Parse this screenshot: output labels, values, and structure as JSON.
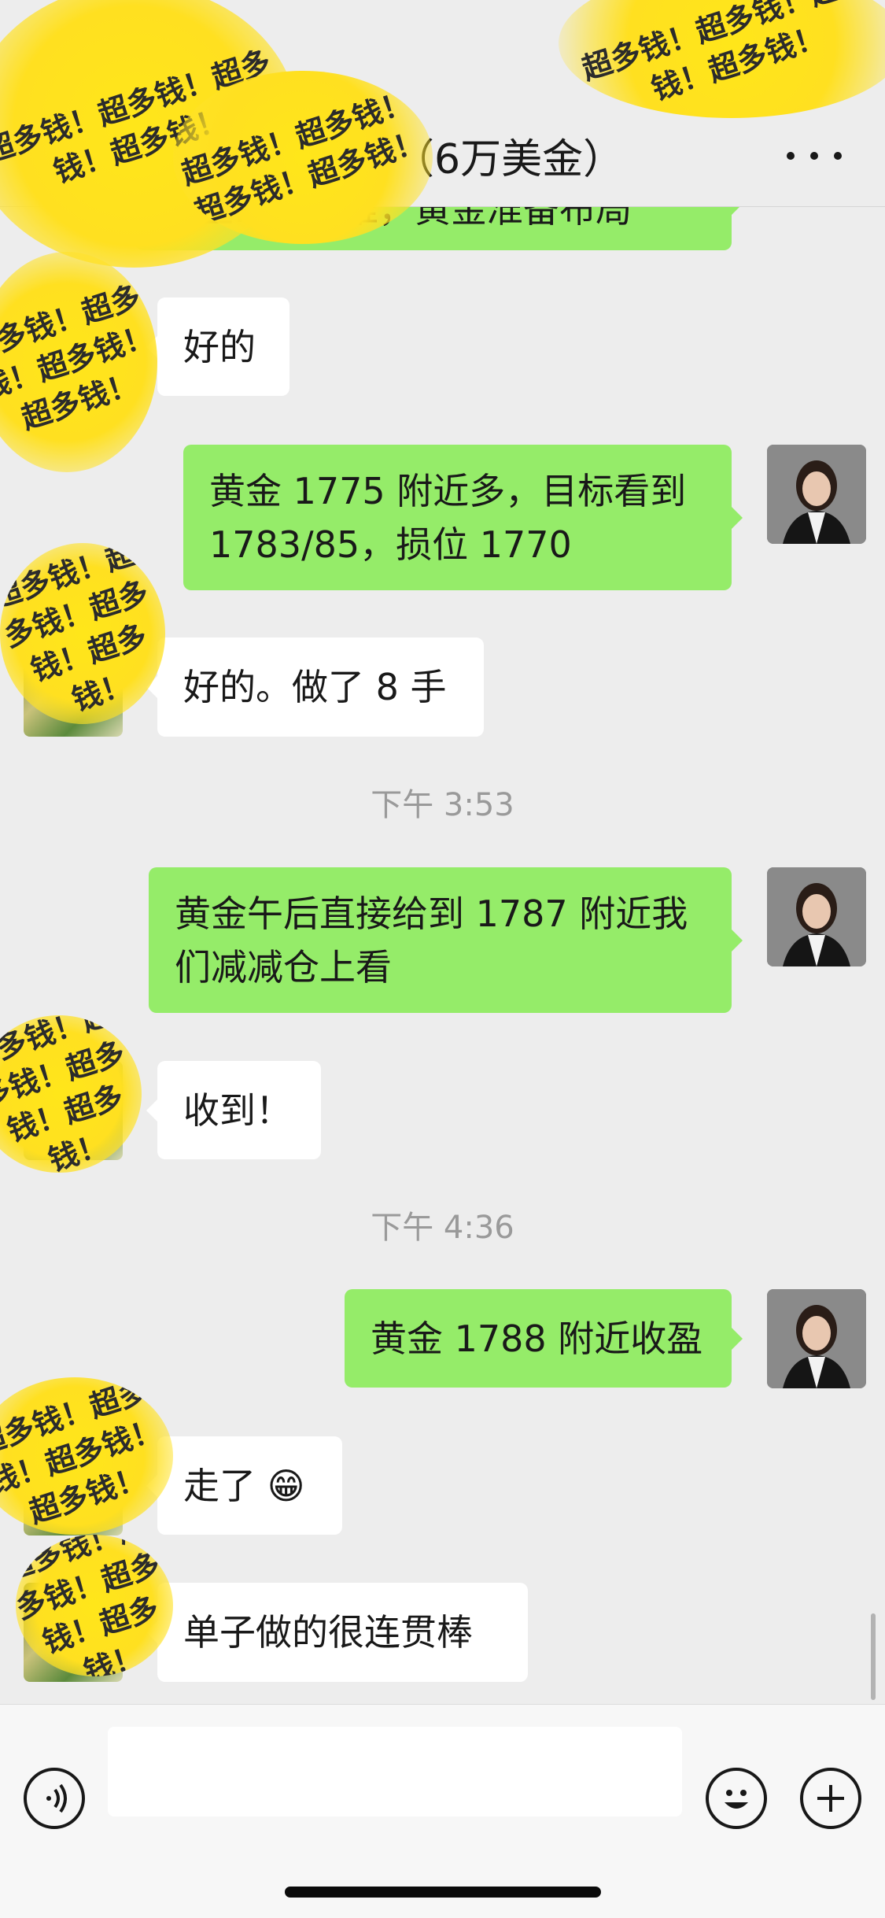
{
  "header": {
    "title": "（6万美金）",
    "more_icon": "more-dots-icon"
  },
  "messages": [
    {
      "side": "out",
      "text": "接上……思维，黄金准备布局"
    },
    {
      "side": "in",
      "text": "好的"
    },
    {
      "side": "out",
      "text": "黄金 1775 附近多，目标看到 1783/85，损位 1770"
    },
    {
      "side": "in",
      "text": "好的。做了 8 手"
    },
    {
      "side": "out",
      "text": "黄金午后直接给到 1787 附近我们减减仓上看"
    },
    {
      "side": "in",
      "text": "收到！"
    },
    {
      "side": "out",
      "text": "黄金 1788 附近收盈"
    },
    {
      "side": "in",
      "text": "走了 😁"
    },
    {
      "side": "in",
      "text": "单子做的很连贯棒"
    }
  ],
  "timestamps": [
    "下午 3:53",
    "下午 4:36"
  ],
  "stickers": {
    "text": "超多钱！超多钱！超多钱！超多钱！"
  },
  "bottom": {
    "voice_icon": "voice-icon",
    "emoji_icon": "emoji-icon",
    "plus_icon": "plus-icon"
  },
  "colors": {
    "background": "#ededed",
    "out_bubble": "#95ec69",
    "in_bubble": "#ffffff",
    "sticker": "#ffe61a"
  }
}
